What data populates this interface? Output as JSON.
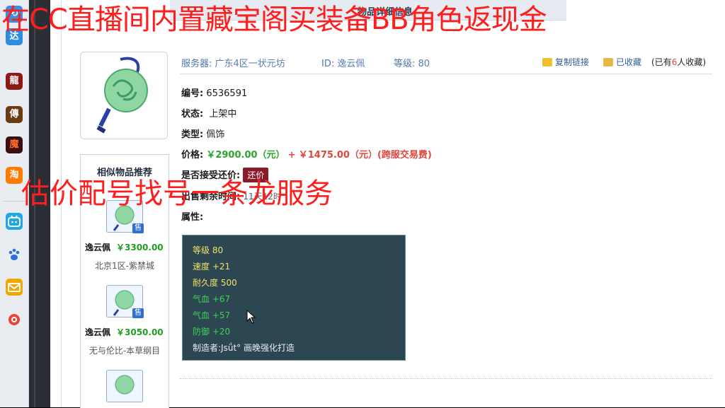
{
  "dock": {
    "icons": [
      "blue-app-icon",
      "game-dragon-icon",
      "game-legend-icon",
      "game-fire-icon",
      "taobao-icon",
      "bilibili-icon",
      "baidu-paw-icon",
      "mail-icon",
      "weibo-icon"
    ],
    "first_label": "达",
    "labels": [
      "龍",
      "傳",
      "魔",
      "淘",
      "",
      "",
      "",
      "",
      ""
    ]
  },
  "topbar": {
    "title": "物品详细信息"
  },
  "header": {
    "server_label": "服务器:",
    "server_value": "广东4区一状元坊",
    "id_label": "ID:",
    "id_value": "逸云佩",
    "level_label": "等级:",
    "level_value": "80",
    "copy_link": "复制链接",
    "collected": "已收藏",
    "collect_count_prefix": "(已有",
    "collect_count": "6",
    "collect_count_suffix": "人收藏)"
  },
  "details": {
    "id_label": "编号:",
    "id_value": "6536591",
    "status_label": "状态:",
    "status_value": "上架中",
    "type_label": "类型:",
    "type_value": "佩饰",
    "price_label": "价格:",
    "price_a": "￥2900.00（元）",
    "plus": "+",
    "price_b": "￥1475.00（元）(跨服交易费)",
    "counter_label": "是否接受还价:",
    "counter_button": "还价",
    "sale_time_label": "出售剩余时间:",
    "sale_time_value": "11天12时",
    "attr_label": "属性:"
  },
  "attributes": [
    {
      "text": "等级 80",
      "color": "yellow"
    },
    {
      "text": "速度 +21",
      "color": "yellow"
    },
    {
      "text": "耐久度 500",
      "color": "yellow"
    },
    {
      "text": "气血 +67",
      "color": "green"
    },
    {
      "text": "气血 +57",
      "color": "green"
    },
    {
      "text": "防御 +20",
      "color": "green"
    },
    {
      "text": "制造者:Jsǘt° 画晚强化打造",
      "color": "white"
    }
  ],
  "similar": {
    "title": "相似物品推荐",
    "sale_tag": "售",
    "items": [
      {
        "name": "逸云佩",
        "price": "￥3300.00",
        "server": "北京1区-紫禁城"
      },
      {
        "name": "逸云佩",
        "price": "￥3050.00",
        "server": "无与伦比-本草纲目"
      }
    ]
  },
  "overlay": {
    "top_text": "在CC直播间内置藏宝阁买装备BB角色返现金",
    "mid_text": "估价配号找号一条龙服务"
  },
  "logo": {
    "line1": "CC直播",
    "line2": "CC直播"
  },
  "colors": {
    "overlay_red": "#ff1d1d",
    "price_green": "#2aa52a",
    "price_red": "#e2463c",
    "attr_bg": "#2c4652"
  }
}
